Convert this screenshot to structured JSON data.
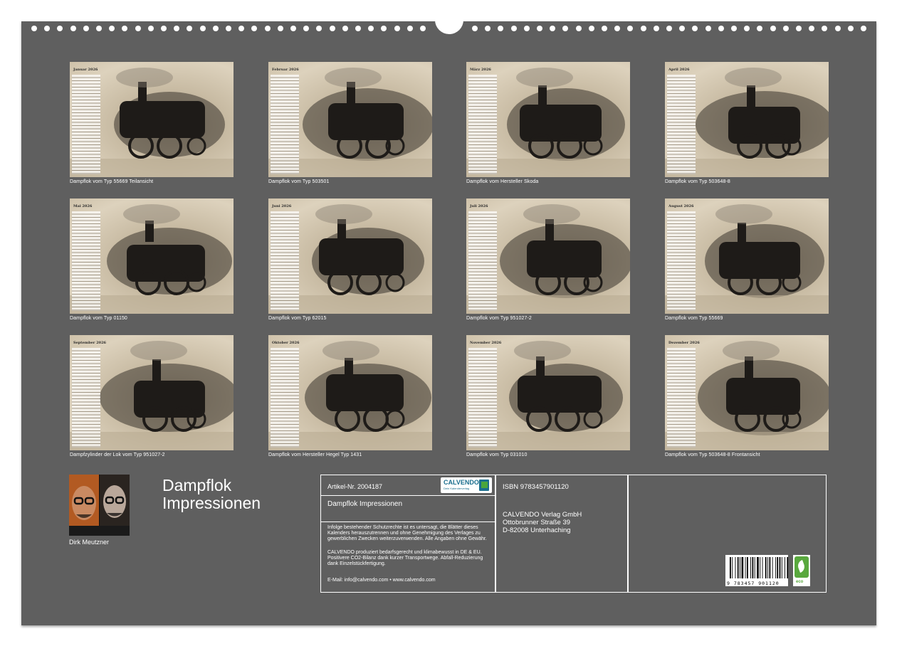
{
  "calendar": {
    "title_line1": "Dampflok",
    "title_line2": "Impressionen",
    "author": "Dirk Meutzner"
  },
  "months": [
    {
      "label": "Januar 2026",
      "caption": "Dampflok vom Typ 55669 Teilansicht"
    },
    {
      "label": "Februar 2026",
      "caption": "Dampflok vom Typ 503501"
    },
    {
      "label": "März 2026",
      "caption": "Dampflok vom Hersteller Skoda"
    },
    {
      "label": "April 2026",
      "caption": "Dampflok vom Typ 503648-8"
    },
    {
      "label": "Mai 2026",
      "caption": "Dampflok vom Typ 01150"
    },
    {
      "label": "Juni 2026",
      "caption": "Dampflok vom Typ 62015"
    },
    {
      "label": "Juli 2026",
      "caption": "Dampflok vom Typ 951027-2"
    },
    {
      "label": "August 2026",
      "caption": "Dampflok vom Typ 55669"
    },
    {
      "label": "September 2026",
      "caption": "Dampfzylinder der Lok vom Typ 951027-2"
    },
    {
      "label": "Oktober 2026",
      "caption": "Dampflok vom Hersteller Hegel Typ 1431"
    },
    {
      "label": "November 2026",
      "caption": "Dampflok vom Typ 031010"
    },
    {
      "label": "Dezember 2026",
      "caption": "Dampflok vom Typ 503648-8 Frontansicht"
    }
  ],
  "imprint": {
    "article_no": "Artikel-Nr. 2004187",
    "logo_brand": "CALVENDO",
    "logo_tagline": "Dein Kalenderverlag",
    "product_title": "Dampflok Impressionen",
    "legal_1": "Infolge bestehender Schutzrechte ist es untersagt, die Blätter dieses Kalenders herauszutrennen und ohne Genehmigung des Verlages zu gewerblichen Zwecken weiterzuverwenden. Alle Angaben ohne Gewähr.",
    "legal_2": "CALVENDO produziert bedarfsgerecht und klimabewusst in DE & EU. Positivere CO2-Bilanz dank kurzer Transportwege. Abfall-Reduzierung dank Einzelstückfertigung.",
    "contact": "E-Mail: info@calvendo.com • www.calvendo.com",
    "isbn": "ISBN 9783457901120",
    "publisher_1": "CALVENDO Verlag GmbH",
    "publisher_2": "Ottobrunner Straße 39",
    "publisher_3": "D-82008 Unterhaching",
    "barcode_digits": "9 783457 901120",
    "eco_label": "eco"
  },
  "colors": {
    "sheet_background": "#5f5f5f",
    "sepia_light": "#ddd2bd",
    "brand_blue": "#1b6e8e",
    "eco_green": "#59a83e"
  }
}
